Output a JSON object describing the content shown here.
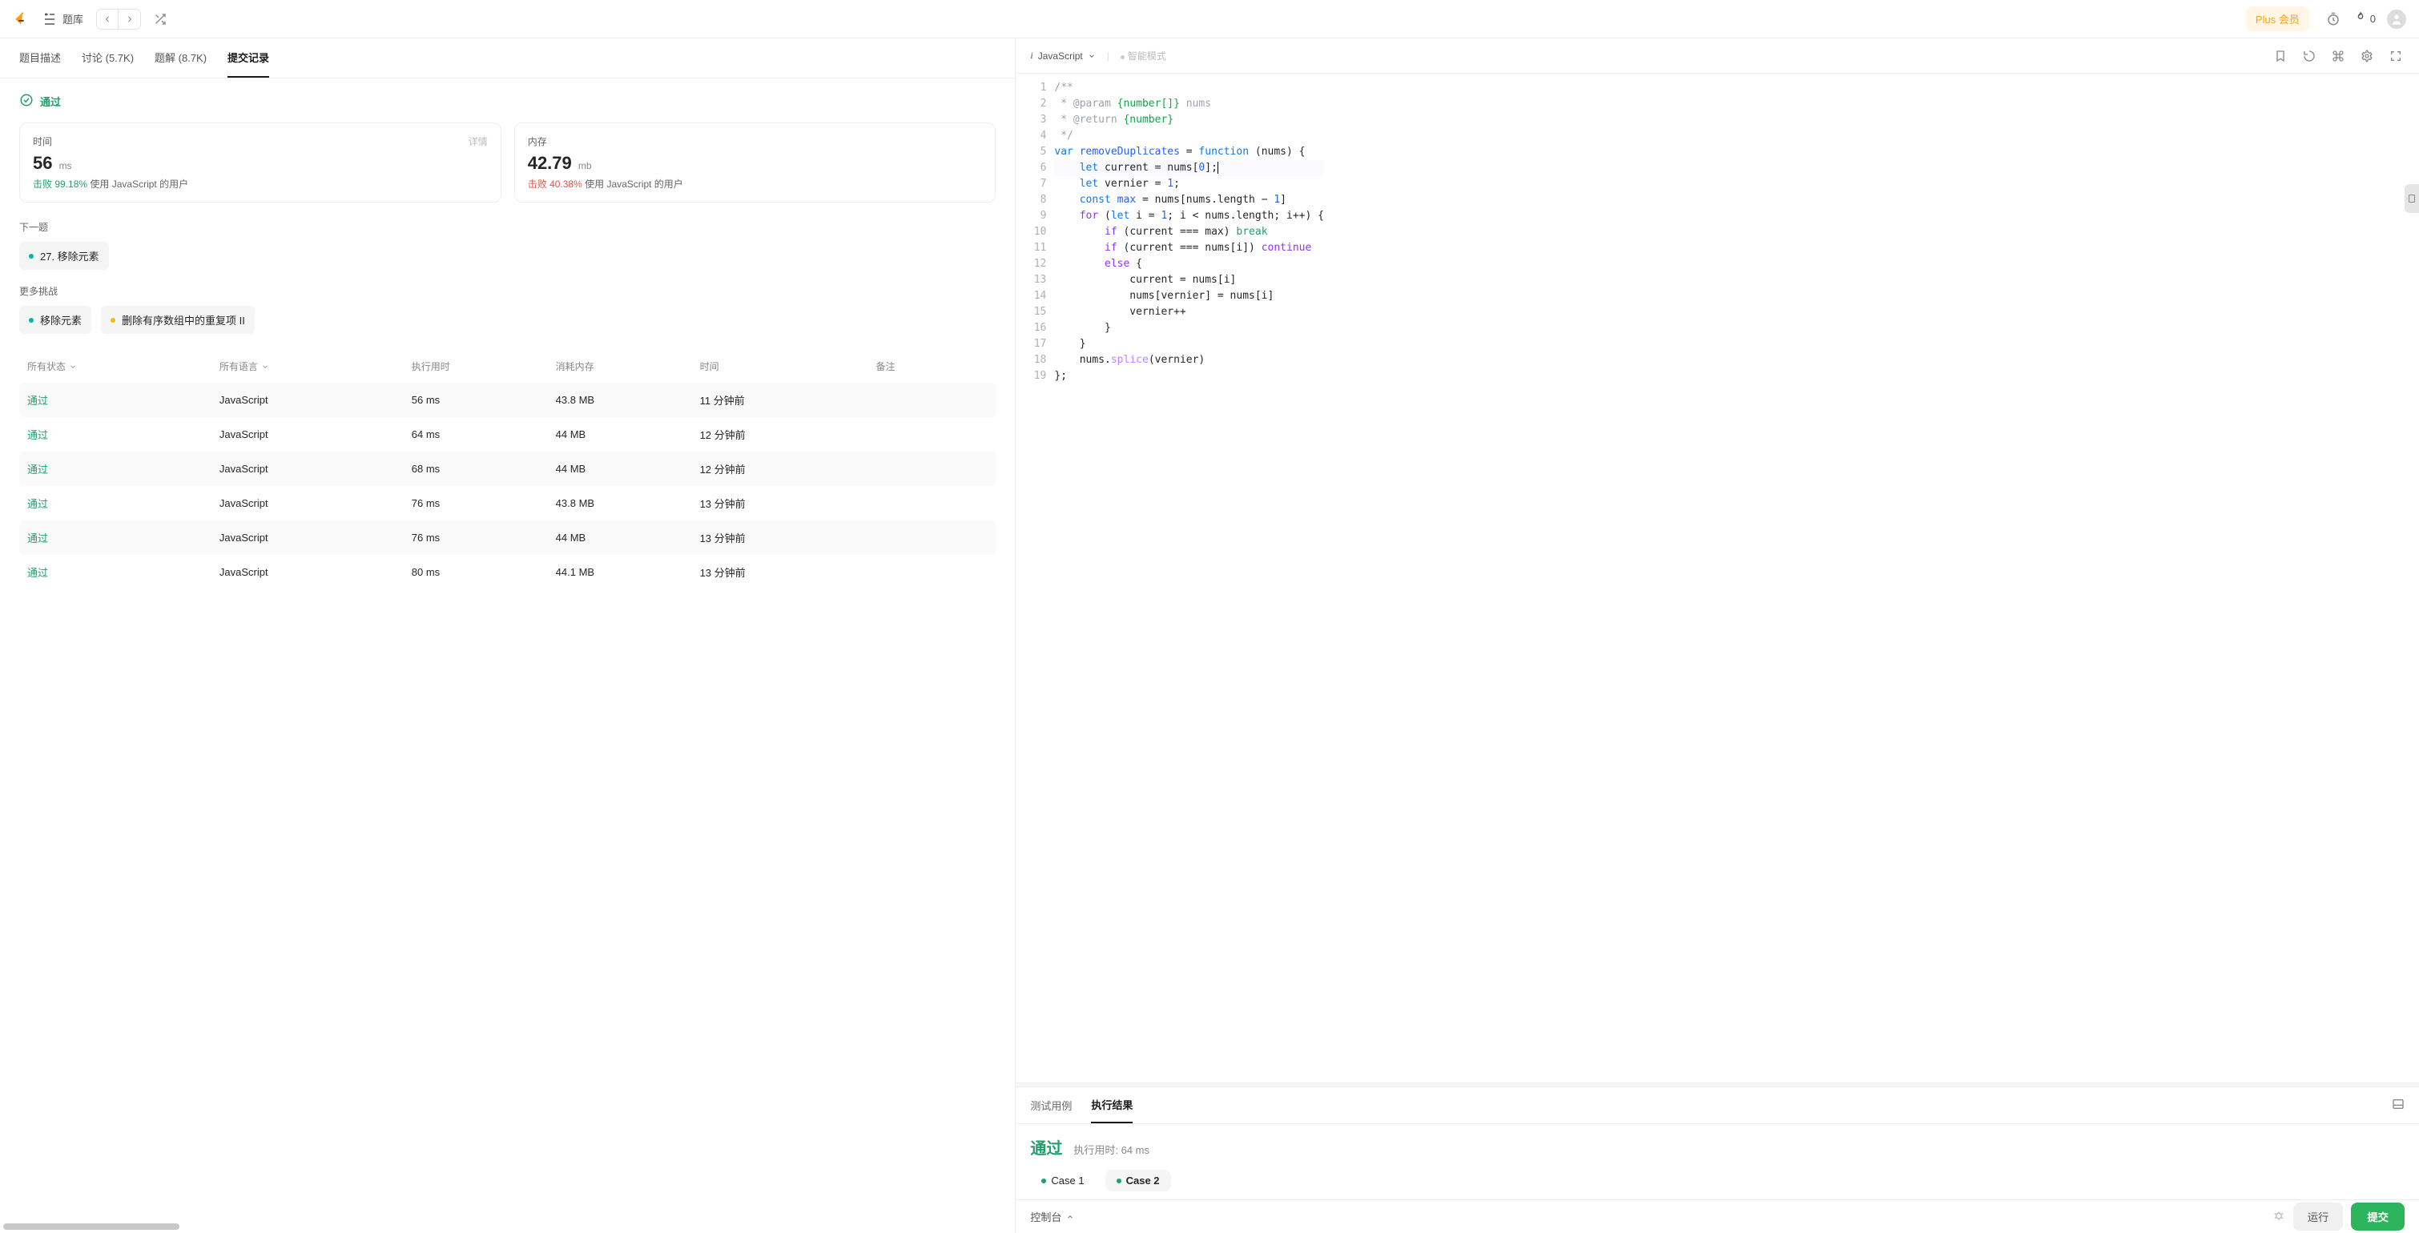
{
  "topbar": {
    "title": "题库",
    "plus_label": "Plus 会员",
    "fire_count": "0"
  },
  "left_tabs": {
    "desc": "题目描述",
    "discuss": "讨论 (5.7K)",
    "solutions": "题解 (8.7K)",
    "submissions": "提交记录"
  },
  "status": {
    "pass": "通过"
  },
  "cards": {
    "time": {
      "label": "时间",
      "detail": "详情",
      "value": "56",
      "unit": "ms",
      "beat_prefix": "击败",
      "beat_pct": "99.18%",
      "beat_suffix": "使用 JavaScript 的用户"
    },
    "memory": {
      "label": "内存",
      "value": "42.79",
      "unit": "mb",
      "beat_prefix": "击败",
      "beat_pct": "40.38%",
      "beat_suffix": "使用 JavaScript 的用户"
    }
  },
  "next": {
    "title": "下一题",
    "chip": "27. 移除元素"
  },
  "more": {
    "title": "更多挑战",
    "chip1": "移除元素",
    "chip2": "删除有序数组中的重复项 II"
  },
  "tbl_head": {
    "status": "所有状态",
    "lang": "所有语言",
    "runtime": "执行用时",
    "memory": "消耗内存",
    "time": "时间",
    "note": "备注"
  },
  "tbl_rows": [
    {
      "status": "通过",
      "lang": "JavaScript",
      "runtime": "56 ms",
      "memory": "43.8 MB",
      "time": "11 分钟前",
      "note": ""
    },
    {
      "status": "通过",
      "lang": "JavaScript",
      "runtime": "64 ms",
      "memory": "44 MB",
      "time": "12 分钟前",
      "note": ""
    },
    {
      "status": "通过",
      "lang": "JavaScript",
      "runtime": "68 ms",
      "memory": "44 MB",
      "time": "12 分钟前",
      "note": ""
    },
    {
      "status": "通过",
      "lang": "JavaScript",
      "runtime": "76 ms",
      "memory": "43.8 MB",
      "time": "13 分钟前",
      "note": ""
    },
    {
      "status": "通过",
      "lang": "JavaScript",
      "runtime": "76 ms",
      "memory": "44 MB",
      "time": "13 分钟前",
      "note": ""
    },
    {
      "status": "通过",
      "lang": "JavaScript",
      "runtime": "80 ms",
      "memory": "44.1 MB",
      "time": "13 分钟前",
      "note": ""
    }
  ],
  "editor": {
    "language": "JavaScript",
    "mode": "智能模式"
  },
  "code_lines": [
    {
      "n": 1,
      "html": "<span class='tok-cmt'>/**</span>"
    },
    {
      "n": 2,
      "html": "<span class='tok-cmt'> * @param </span><span class='tok-type'>{number[]}</span><span class='tok-cmt'> nums</span>"
    },
    {
      "n": 3,
      "html": "<span class='tok-cmt'> * @return </span><span class='tok-type'>{number}</span>"
    },
    {
      "n": 4,
      "html": "<span class='tok-cmt'> */</span>"
    },
    {
      "n": 5,
      "html": "<span class='tok-kw'>var</span> <span class='tok-var'>removeDuplicates</span> = <span class='tok-kw'>function</span> (nums) {"
    },
    {
      "n": 6,
      "html": "    <span class='tok-kw'>let</span> current = nums[<span class='tok-num'>0</span>];<span class='caret'></span>",
      "cursor": true
    },
    {
      "n": 7,
      "html": "    <span class='tok-kw'>let</span> vernier = <span class='tok-num'>1</span>;"
    },
    {
      "n": 8,
      "html": "    <span class='tok-kw'>const</span> <span class='tok-var'>max</span> = nums[nums.length − <span class='tok-num'>1</span>]"
    },
    {
      "n": 9,
      "html": "    <span class='tok-kw2'>for</span> (<span class='tok-kw'>let</span> i = <span class='tok-num'>1</span>; i &lt; nums.length; i++) {"
    },
    {
      "n": 10,
      "html": "        <span class='tok-kw2'>if</span> (current === max) <span class='tok-br'>break</span>"
    },
    {
      "n": 11,
      "html": "        <span class='tok-kw2'>if</span> (current === nums[i]) <span class='tok-ct'>continue</span>"
    },
    {
      "n": 12,
      "html": "        <span class='tok-kw2'>else</span> {"
    },
    {
      "n": 13,
      "html": "            current = nums[i]"
    },
    {
      "n": 14,
      "html": "            nums[vernier] = nums[i]"
    },
    {
      "n": 15,
      "html": "            vernier++"
    },
    {
      "n": 16,
      "html": "        }"
    },
    {
      "n": 17,
      "html": "    }"
    },
    {
      "n": 18,
      "html": "    nums.<span class='tok-fn'>splice</span>(vernier)"
    },
    {
      "n": 19,
      "html": "};"
    }
  ],
  "result_tabs": {
    "tests": "测试用例",
    "result": "执行结果"
  },
  "result": {
    "pass": "通过",
    "runtime_label": "执行用时: 64 ms",
    "case1": "Case 1",
    "case2": "Case 2"
  },
  "console": {
    "label": "控制台",
    "run": "运行",
    "submit": "提交"
  }
}
